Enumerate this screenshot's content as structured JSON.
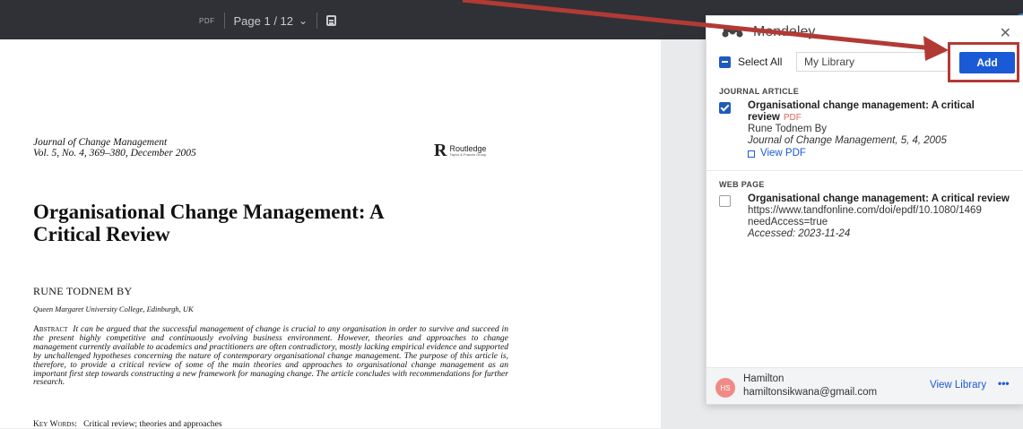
{
  "viewer": {
    "file_type": "PDF",
    "page_indicator": "Page 1 / 12"
  },
  "document": {
    "journal_line1": "Journal of Change Management",
    "journal_line2": "Vol. 5, No. 4, 369–380, December 2005",
    "publisher_logo": "Routledge",
    "publisher_sub": "Taylor & Francis Group",
    "title_line1": "Organisational Change Management: A",
    "title_line2": "Critical Review",
    "author": "RUNE TODNEM BY",
    "affiliation": "Queen Margaret University College, Edinburgh, UK",
    "abstract_label": "Abstract",
    "abstract_text": "It can be argued that the successful management of change is crucial to any organisation in order to survive and succeed in the present highly competitive and continuously evolving business environment. However, theories and approaches to change management currently available to academics and practitioners are often contradictory, mostly lacking empirical evidence and supported by unchallenged hypotheses concerning the nature of contemporary organisational change management. The purpose of this article is, therefore, to provide a critical review of some of the main theories and approaches to organisational change management as an important first step towards constructing a new framework for managing change. The article concludes with recommendations for further research.",
    "keywords_label": "Key Words:",
    "keywords_text": "Critical review; theories and approaches"
  },
  "panel": {
    "title": "Mendeley",
    "close_icon": "close-icon",
    "select_all_label": "Select All",
    "library_value": "My Library",
    "add_label": "Add",
    "sections": {
      "journal": {
        "label": "JOURNAL ARTICLE",
        "title": "Organisational change management: A critical review",
        "badge": "PDF",
        "authors": "Rune Todnem By",
        "citation": "Journal of Change Management, 5, 4, 2005",
        "view_pdf": "View PDF",
        "checked": true
      },
      "web": {
        "label": "WEB PAGE",
        "title": "Organisational change management: A critical review",
        "url": "https://www.tandfonline.com/doi/epdf/10.1080/1469",
        "url2": "needAccess=true",
        "accessed": "Accessed: 2023-11-24",
        "checked": false
      }
    },
    "footer": {
      "avatar_initials": "HS",
      "user_name": "Hamilton",
      "user_email": "hamiltonsikwana@gmail.com",
      "view_library": "View Library",
      "more": "•••"
    }
  },
  "colors": {
    "toolbar": "#2f3136",
    "accent": "#1a5ad6",
    "annotation": "#b23a35"
  }
}
